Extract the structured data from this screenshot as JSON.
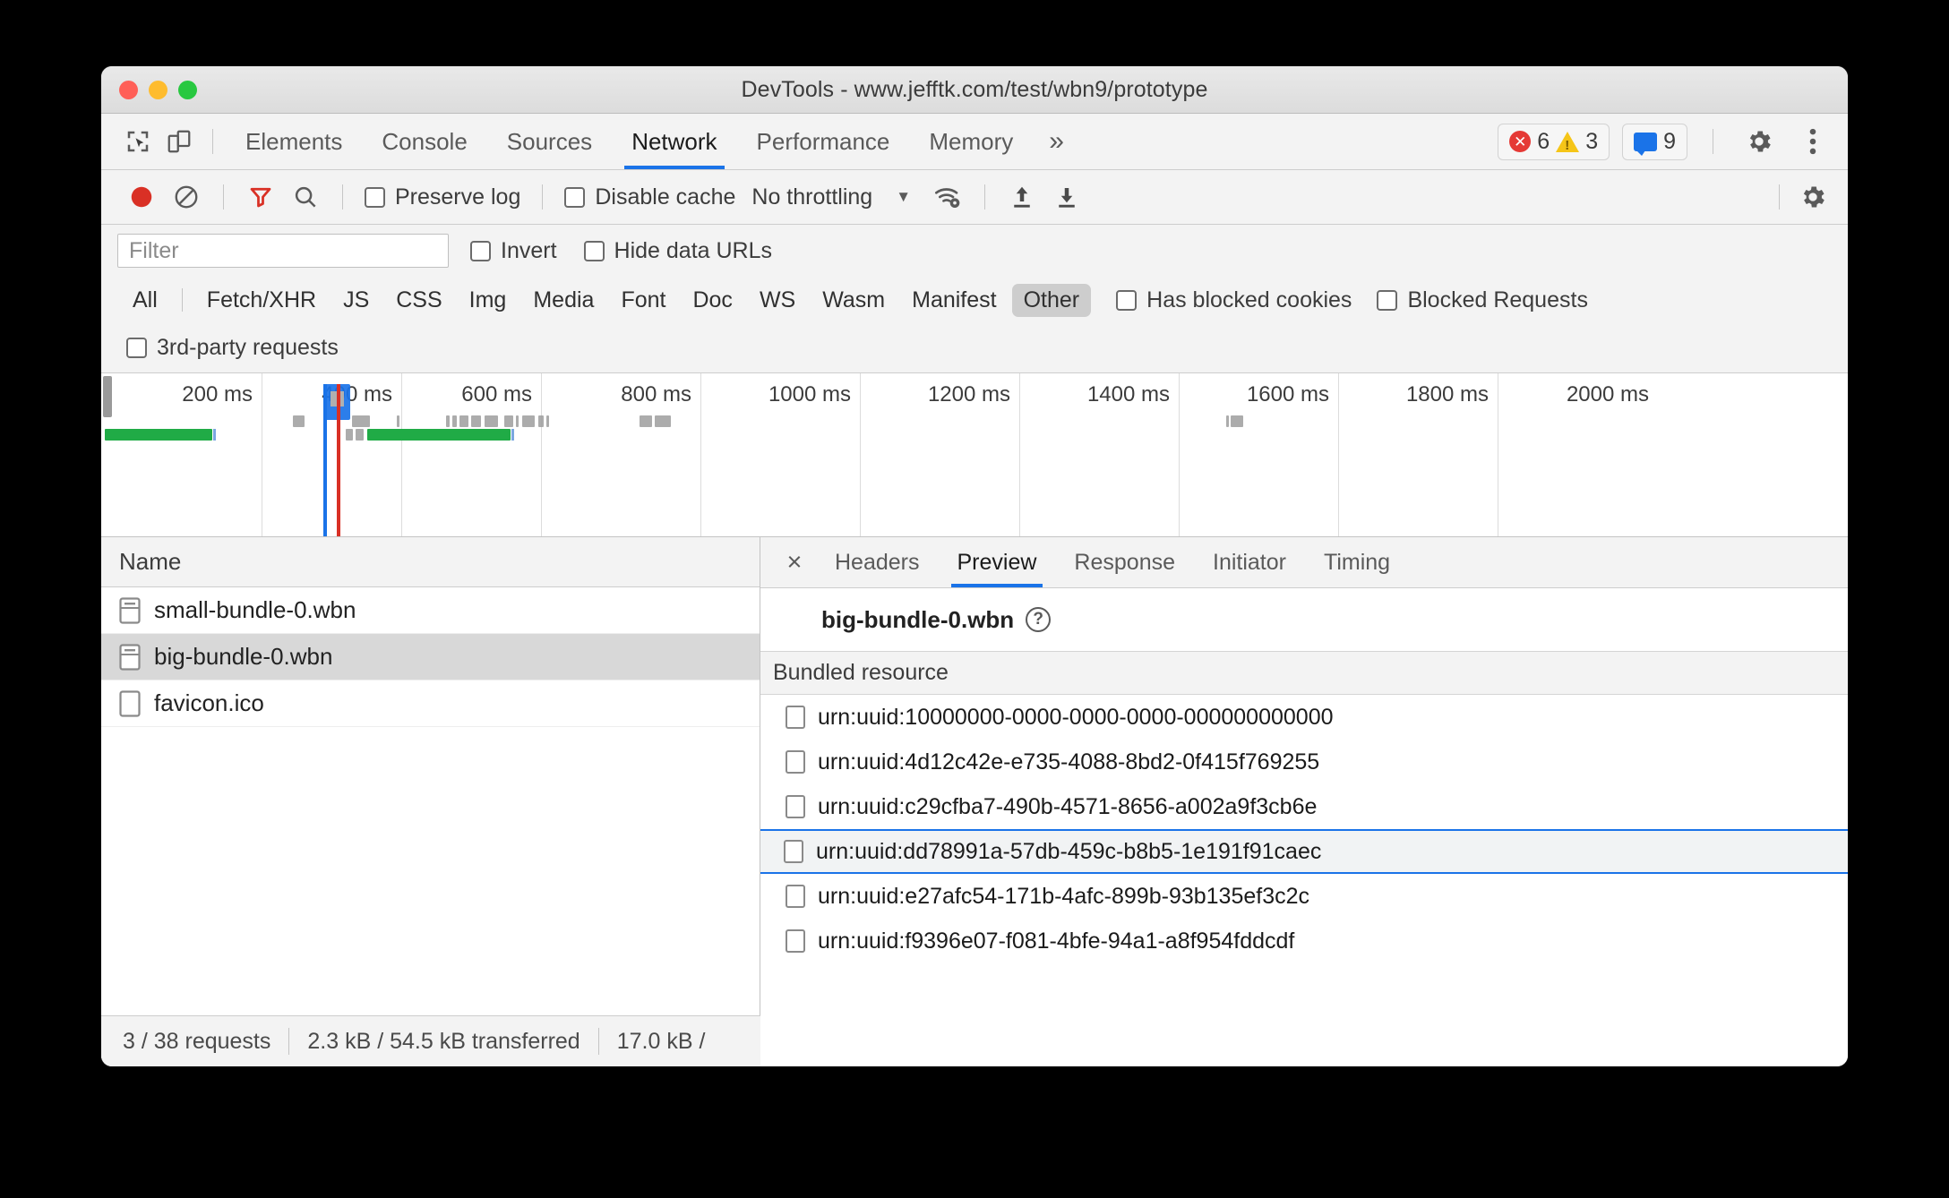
{
  "window": {
    "title": "DevTools - www.jefftk.com/test/wbn9/prototype",
    "traffic_lights": [
      "close",
      "minimize",
      "maximize"
    ]
  },
  "tabbar": {
    "inspect_icon": "cursor-select-icon",
    "device_icon": "device-toolbar-icon",
    "tabs": [
      {
        "label": "Elements",
        "active": false
      },
      {
        "label": "Console",
        "active": false
      },
      {
        "label": "Sources",
        "active": false
      },
      {
        "label": "Network",
        "active": true
      },
      {
        "label": "Performance",
        "active": false
      },
      {
        "label": "Memory",
        "active": false
      }
    ],
    "more_label": "»",
    "errors": "6",
    "warnings": "3",
    "messages": "9",
    "settings_icon": "gear-icon",
    "menu_icon": "kebab-menu-icon"
  },
  "toolbar": {
    "record_icon": "record-stop-icon",
    "clear_icon": "clear-prohibited-icon",
    "filter_icon": "funnel-filter-icon",
    "search_icon": "search-icon",
    "preserve_log_label": "Preserve log",
    "preserve_log_checked": false,
    "disable_cache_label": "Disable cache",
    "disable_cache_checked": false,
    "throttling_value": "No throttling",
    "throttle_caret": "▼",
    "wifi_icon": "network-conditions-icon",
    "upload_icon": "import-har-icon",
    "download_icon": "export-har-icon",
    "settings_icon": "network-settings-gear-icon"
  },
  "filter": {
    "placeholder": "Filter",
    "value": "",
    "invert_label": "Invert",
    "invert_checked": false,
    "hide_data_urls_label": "Hide data URLs",
    "hide_data_urls_checked": false,
    "types": [
      {
        "label": "All",
        "selected": false
      },
      {
        "label": "Fetch/XHR",
        "selected": false
      },
      {
        "label": "JS",
        "selected": false
      },
      {
        "label": "CSS",
        "selected": false
      },
      {
        "label": "Img",
        "selected": false
      },
      {
        "label": "Media",
        "selected": false
      },
      {
        "label": "Font",
        "selected": false
      },
      {
        "label": "Doc",
        "selected": false
      },
      {
        "label": "WS",
        "selected": false
      },
      {
        "label": "Wasm",
        "selected": false
      },
      {
        "label": "Manifest",
        "selected": false
      },
      {
        "label": "Other",
        "selected": true
      }
    ],
    "has_blocked_cookies_label": "Has blocked cookies",
    "has_blocked_cookies_checked": false,
    "blocked_requests_label": "Blocked Requests",
    "blocked_requests_checked": false,
    "third_party_label": "3rd-party requests",
    "third_party_checked": false
  },
  "overview": {
    "ticks": [
      "200 ms",
      "400 ms",
      "600 ms",
      "800 ms",
      "1000 ms",
      "1200 ms",
      "1400 ms",
      "1600 ms",
      "1800 ms",
      "2000 ms"
    ],
    "dcl_marker_color": "#1a73e8",
    "load_marker_color": "#d93025",
    "bar_color": "#20ab46"
  },
  "request_list": {
    "column_header": "Name",
    "rows": [
      {
        "name": "small-bundle-0.wbn",
        "icon": "webbundle-document-icon",
        "selected": false
      },
      {
        "name": "big-bundle-0.wbn",
        "icon": "webbundle-document-icon",
        "selected": true
      },
      {
        "name": "favicon.ico",
        "icon": "generic-document-icon",
        "selected": false
      }
    ]
  },
  "detail": {
    "close_label": "×",
    "tabs": [
      {
        "label": "Headers",
        "active": false
      },
      {
        "label": "Preview",
        "active": true
      },
      {
        "label": "Response",
        "active": false
      },
      {
        "label": "Initiator",
        "active": false
      },
      {
        "label": "Timing",
        "active": false
      }
    ],
    "preview": {
      "title": "big-bundle-0.wbn",
      "help_glyph": "?",
      "column_header": "Bundled resource",
      "resources": [
        {
          "urn": "urn:uuid:10000000-0000-0000-0000-000000000000",
          "selected": false
        },
        {
          "urn": "urn:uuid:4d12c42e-e735-4088-8bd2-0f415f769255",
          "selected": false
        },
        {
          "urn": "urn:uuid:c29cfba7-490b-4571-8656-a002a9f3cb6e",
          "selected": false
        },
        {
          "urn": "urn:uuid:dd78991a-57db-459c-b8b5-1e191f91caec",
          "selected": true
        },
        {
          "urn": "urn:uuid:e27afc54-171b-4afc-899b-93b135ef3c2c",
          "selected": false
        },
        {
          "urn": "urn:uuid:f9396e07-f081-4bfe-94a1-a8f954fddcdf",
          "selected": false
        }
      ]
    }
  },
  "statusbar": {
    "requests": "3 / 38 requests",
    "transferred": "2.3 kB / 54.5 kB transferred",
    "resources": "17.0 kB /"
  },
  "colors": {
    "accent": "#1a73e8",
    "error": "#e53935",
    "warning": "#f5c518",
    "success": "#20ab46",
    "record": "#d93025",
    "selected_row": "#d8d8d8",
    "chip_selected": "#cdcdcd"
  }
}
